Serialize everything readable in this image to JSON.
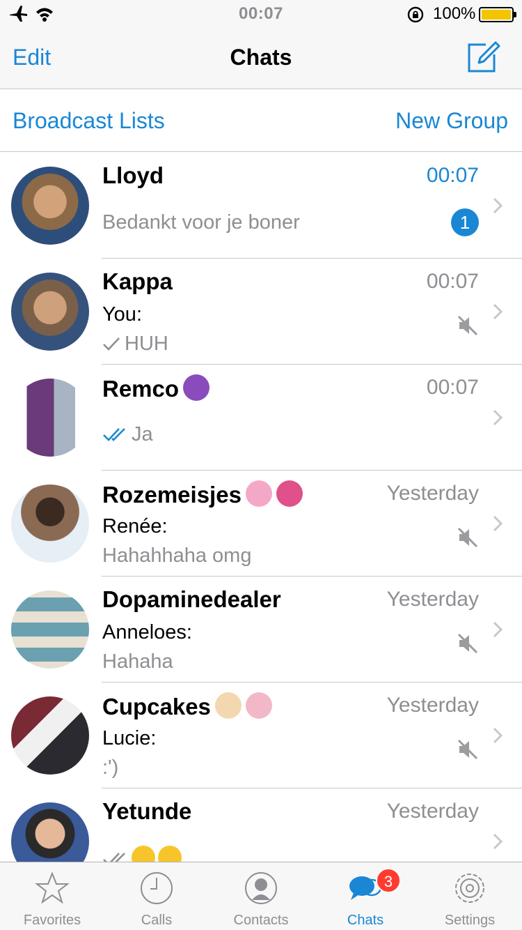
{
  "status_bar": {
    "time": "00:07",
    "battery_percent": "100%",
    "battery_level": 1.0
  },
  "nav": {
    "edit_label": "Edit",
    "title": "Chats",
    "compose_icon": "compose-icon"
  },
  "actions": {
    "broadcast_label": "Broadcast Lists",
    "new_group_label": "New Group"
  },
  "chats": [
    {
      "name": "Lloyd",
      "time": "00:07",
      "sender": "",
      "preview": "Bedankt voor je boner",
      "unread": "1",
      "muted": false,
      "avatar_color": "#9a7e60"
    },
    {
      "name": "Kappa",
      "time": "00:07",
      "sender": "You:",
      "preview": "HUH",
      "receipt": "single-check",
      "muted": true,
      "avatar_color": "#8a7a66"
    },
    {
      "name": "Remco",
      "emoji": [
        "devil-emoji"
      ],
      "time": "00:07",
      "sender": "",
      "preview": "Ja",
      "receipt": "double-check-blue",
      "muted": false,
      "avatar_color": "#6a3a7a"
    },
    {
      "name": "Rozemeisjes",
      "emoji": [
        "cherry-blossom-emoji",
        "ribbon-emoji"
      ],
      "time": "Yesterday",
      "sender": "Renée:",
      "preview": "Hahahhaha omg",
      "muted": true,
      "avatar_color": "#5a4a3a"
    },
    {
      "name": "Dopaminedealer",
      "time": "Yesterday",
      "sender": "Anneloes:",
      "preview": "Hahaha",
      "muted": true,
      "avatar_color": "#6aa0b0"
    },
    {
      "name": "Cupcakes",
      "emoji": [
        "cake-emoji",
        "no-gesture-emoji"
      ],
      "time": "Yesterday",
      "sender": "Lucie:",
      "preview": ":')",
      "muted": true,
      "avatar_color": "#5a4440"
    },
    {
      "name": "Yetunde",
      "time": "Yesterday",
      "sender": "",
      "preview": "",
      "receipt": "double-check-grey",
      "preview_emoji": [
        "tears-of-joy-emoji",
        "tears-of-joy-emoji"
      ],
      "muted": false,
      "avatar_color": "#3a5a9a"
    }
  ],
  "tabs": [
    {
      "label": "Favorites",
      "icon": "star-icon"
    },
    {
      "label": "Calls",
      "icon": "clock-icon"
    },
    {
      "label": "Contacts",
      "icon": "contact-icon"
    },
    {
      "label": "Chats",
      "icon": "chat-bubbles-icon",
      "badge": "3",
      "active": true
    },
    {
      "label": "Settings",
      "icon": "gear-icon"
    }
  ],
  "colors": {
    "accent": "#1a87d4",
    "badge_red": "#ff3b30",
    "battery": "#f5c400"
  }
}
